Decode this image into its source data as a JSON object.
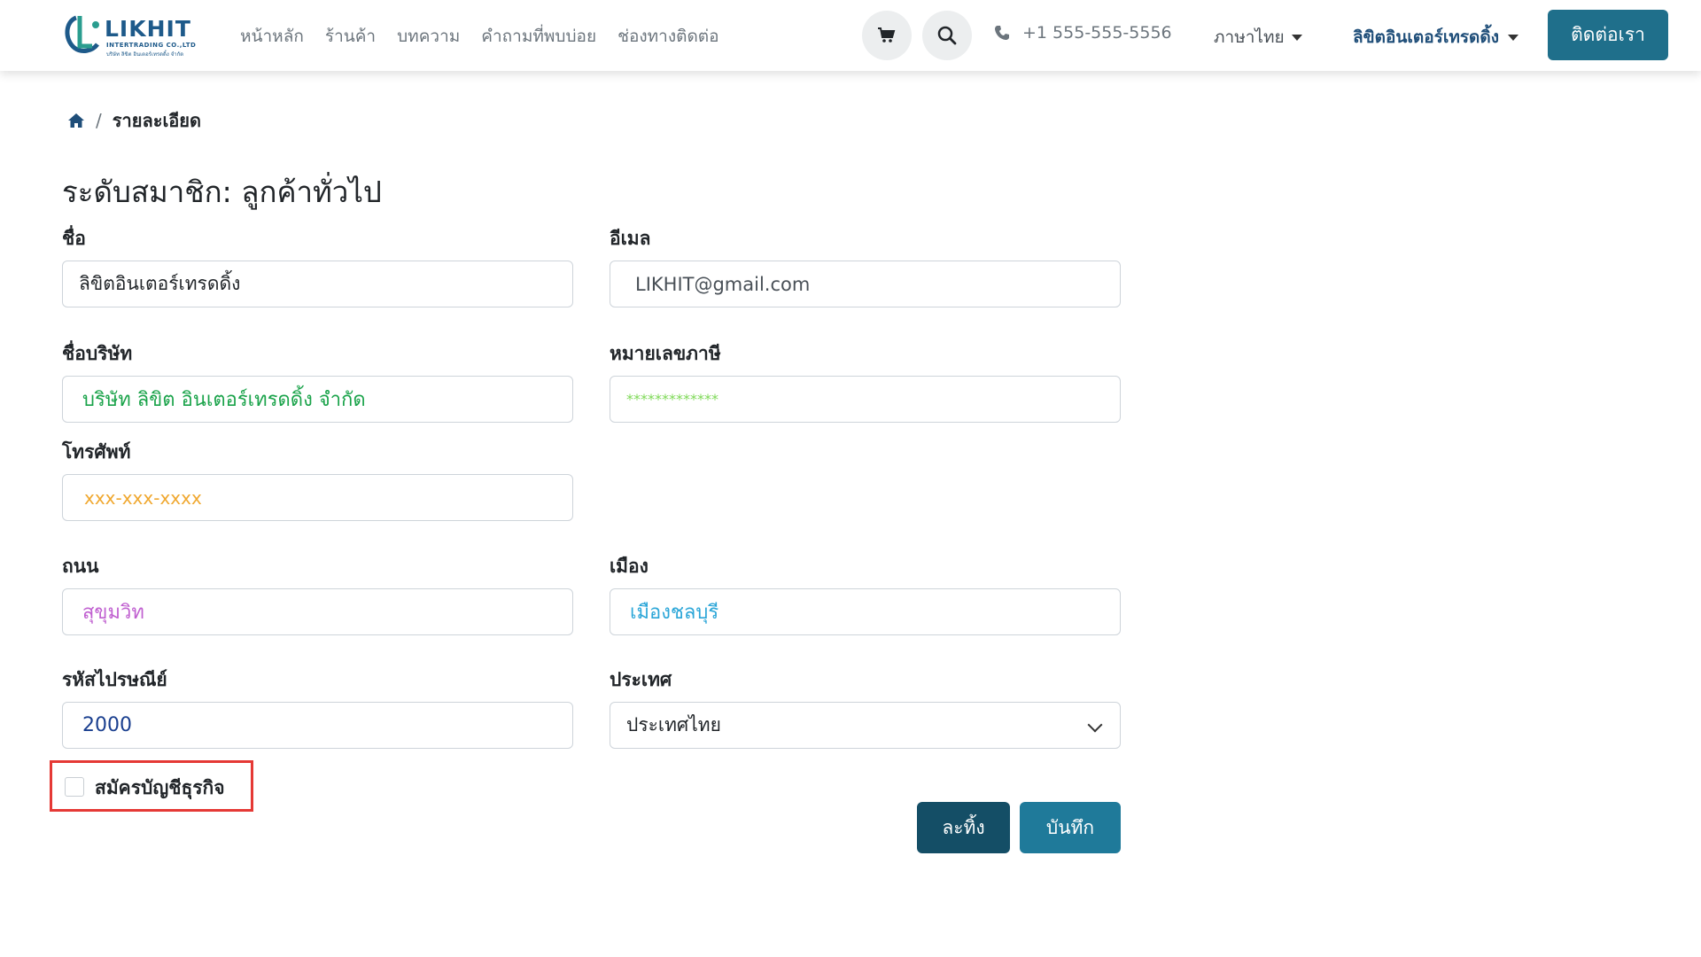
{
  "header": {
    "logo_text": "LIKHIT",
    "logo_subtitle": "INTERTRADING CO.,LTD",
    "logo_subtitle_th": "บริษัท ลิขิต อินเตอร์เทรดดิ้ง จำกัด",
    "nav": [
      {
        "label": "หน้าหลัก"
      },
      {
        "label": "ร้านค้า"
      },
      {
        "label": "บทความ"
      },
      {
        "label": "คำถามที่พบบ่อย"
      },
      {
        "label": "ช่องทางติดต่อ"
      }
    ],
    "phone": "+1 555-555-5556",
    "language": "ภาษาไทย",
    "user_name": "ลิขิตอินเตอร์เทรดดิ้ง",
    "contact_button": "ติดต่อเรา"
  },
  "breadcrumb": {
    "current": "รายละเอียด"
  },
  "page_title": "ระดับสมาชิก: ลูกค้าทั่วไป",
  "form": {
    "name_label": "ชื่อ",
    "name_value": "ลิขิตอินเตอร์เทรดดิ้ง",
    "email_label": "อีเมล",
    "email_value": "LIKHIT@gmail.com",
    "company_label": "ชื่อบริษัท",
    "company_value": "บริษัท ลิขิต อินเตอร์เทรดดิ้ง จำกัด",
    "tax_label": "หมายเลขภาษี",
    "tax_value": "*************",
    "phone_label": "โทรศัพท์",
    "phone_value": "xxx-xxx-xxxx",
    "street_label": "ถนน",
    "street_value": "สุขุมวิท",
    "city_label": "เมือง",
    "city_value": "เมืองชลบุรี",
    "zip_label": "รหัสไปรษณีย์",
    "zip_value": "2000",
    "country_label": "ประเทศ",
    "country_value": "ประเทศไทย",
    "business_checkbox_label": "สมัครบัญชีธุรกิจ",
    "discard_button": "ละทิ้ง",
    "save_button": "บันทึก"
  },
  "colors": {
    "primary": "#1f7a9a",
    "primary_dark": "#144e66",
    "company_text": "#1aa34a",
    "tax_text": "#7ed957",
    "phone_text": "#f0a830",
    "street_text": "#c060d0",
    "city_text": "#2ba6d8",
    "zip_text": "#1a3f8f",
    "highlight_border": "#e53935"
  }
}
